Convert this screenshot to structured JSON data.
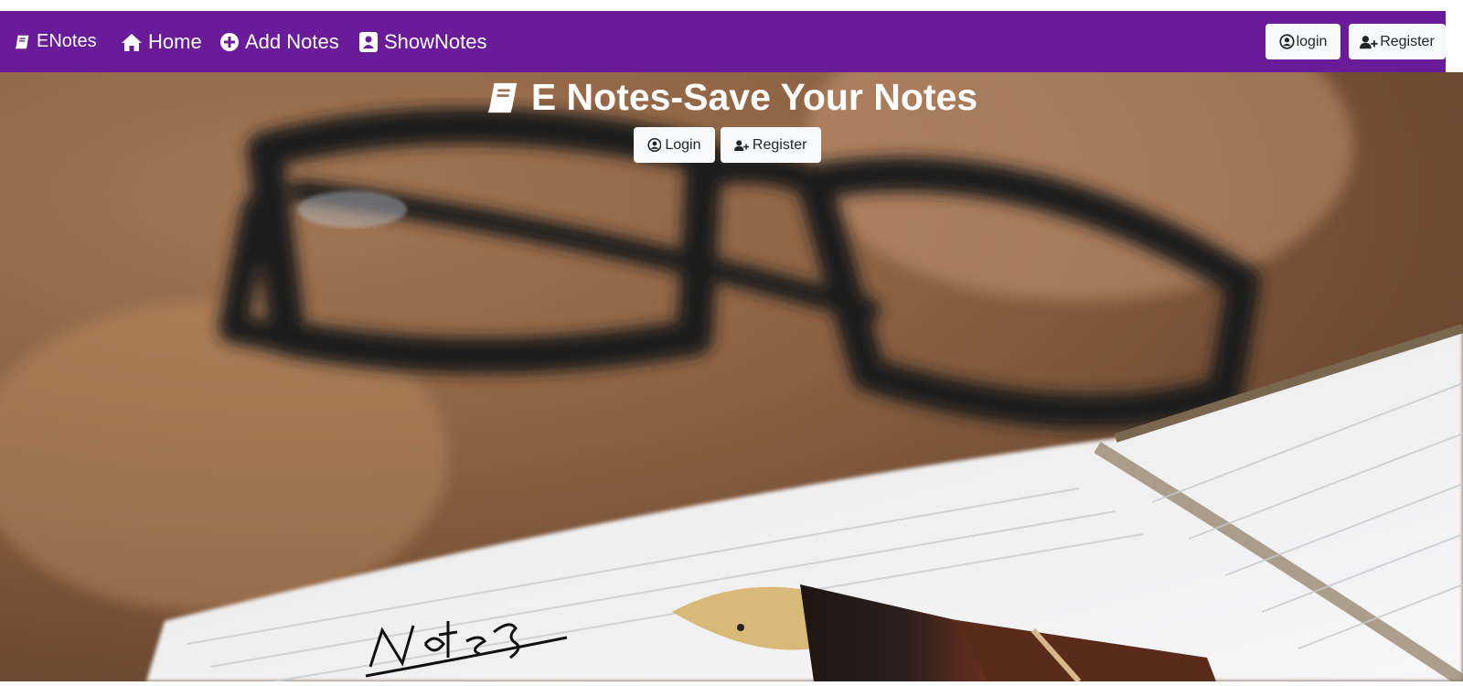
{
  "navbar": {
    "brand": "ENotes",
    "home": "Home",
    "add_notes": "Add Notes",
    "show_notes": "ShowNotes",
    "login": "login",
    "register": "Register",
    "background": "#6a1b9a"
  },
  "hero": {
    "title": "E Notes-Save Your Notes",
    "login": "Login",
    "register": "Register"
  },
  "icons": [
    "book-icon",
    "home-icon",
    "plus-circle-icon",
    "address-book-icon",
    "user-circle-icon",
    "user-plus-icon"
  ]
}
